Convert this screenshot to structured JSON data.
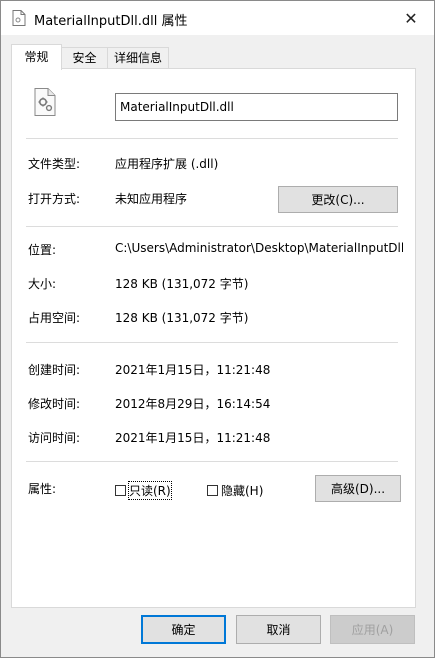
{
  "window": {
    "title": "MaterialInputDll.dll 属性",
    "close_glyph": "✕"
  },
  "tabs": [
    {
      "label": "常规",
      "active": true
    },
    {
      "label": "安全",
      "active": false
    },
    {
      "label": "详细信息",
      "active": false
    }
  ],
  "general": {
    "file_name": "MaterialInputDll.dll",
    "file_type_label": "文件类型:",
    "file_type_value": "应用程序扩展 (.dll)",
    "open_with_label": "打开方式:",
    "open_with_value": "未知应用程序",
    "change_button": "更改(C)...",
    "location_label": "位置:",
    "location_value": "C:\\Users\\Administrator\\Desktop\\MaterialInputDll",
    "size_label": "大小:",
    "size_value": "128 KB (131,072 字节)",
    "size_on_disk_label": "占用空间:",
    "size_on_disk_value": "128 KB (131,072 字节)",
    "created_label": "创建时间:",
    "created_value": "2021年1月15日，11:21:48",
    "modified_label": "修改时间:",
    "modified_value": "2012年8月29日，16:14:54",
    "accessed_label": "访问时间:",
    "accessed_value": "2021年1月15日，11:21:48",
    "attributes_label": "属性:",
    "readonly_label": "只读(R)",
    "hidden_label": "隐藏(H)",
    "advanced_button": "高级(D)..."
  },
  "footer": {
    "ok": "确定",
    "cancel": "取消",
    "apply": "应用(A)"
  },
  "colors": {
    "accent": "#0078d7",
    "panel": "#ffffff",
    "chrome": "#f0f0f0"
  }
}
